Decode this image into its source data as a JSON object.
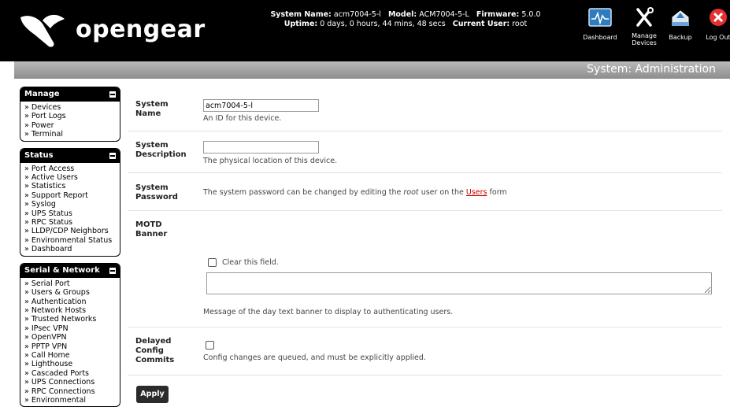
{
  "header": {
    "logo_text": "opengear",
    "system_name_label": "System Name:",
    "system_name": "acm7004-5-l",
    "model_label": "Model:",
    "model": "ACM7004-5-L",
    "firmware_label": "Firmware:",
    "firmware": "5.0.0",
    "uptime_label": "Uptime:",
    "uptime": "0 days, 0 hours, 44 mins, 48 secs",
    "current_user_label": "Current User:",
    "current_user": "root",
    "nav": {
      "dashboard": "Dashboard",
      "manage_devices_1": "Manage",
      "manage_devices_2": "Devices",
      "backup": "Backup",
      "logout": "Log Out"
    }
  },
  "page": {
    "title": "System: Administration"
  },
  "sidebar": {
    "manage": {
      "title": "Manage",
      "items": [
        "Devices",
        "Port Logs",
        "Power",
        "Terminal"
      ]
    },
    "status": {
      "title": "Status",
      "items": [
        "Port Access",
        "Active Users",
        "Statistics",
        "Support Report",
        "Syslog",
        "UPS Status",
        "RPC Status",
        "LLDP/CDP Neighbors",
        "Environmental Status",
        "Dashboard"
      ]
    },
    "serial_network": {
      "title": "Serial & Network",
      "items": [
        "Serial Port",
        "Users & Groups",
        "Authentication",
        "Network Hosts",
        "Trusted Networks",
        "IPsec VPN",
        "OpenVPN",
        "PPTP VPN",
        "Call Home",
        "Lighthouse",
        "Cascaded Ports",
        "UPS Connections",
        "RPC Connections",
        "Environmental"
      ]
    }
  },
  "form": {
    "system_name": {
      "label_1": "System",
      "label_2": "Name",
      "value": "acm7004-5-l",
      "hint": "An ID for this device."
    },
    "system_description": {
      "label_1": "System",
      "label_2": "Description",
      "value": "",
      "hint": "The physical location of this device."
    },
    "system_password": {
      "label_1": "System",
      "label_2": "Password",
      "text_before": "The system password can be changed by editing the ",
      "text_em": "root",
      "text_mid": " user on the ",
      "link": "Users",
      "text_after": " form"
    },
    "motd": {
      "label_1": "MOTD",
      "label_2": "Banner",
      "clear_label": "Clear this field.",
      "clear_checked": false,
      "value": "",
      "hint": "Message of the day text banner to display to authenticating users."
    },
    "delayed_config": {
      "label_1": "Delayed",
      "label_2": "Config",
      "label_3": "Commits",
      "checked": false,
      "hint": "Config changes are queued, and must be explicitly applied."
    },
    "apply_label": "Apply"
  },
  "colors": {
    "header_bg": "#000000",
    "title_bar": "#9e9e9e",
    "link_red": "#cc0000",
    "logout_red": "#e53030",
    "dashboard_blue": "#2f7bbf"
  }
}
